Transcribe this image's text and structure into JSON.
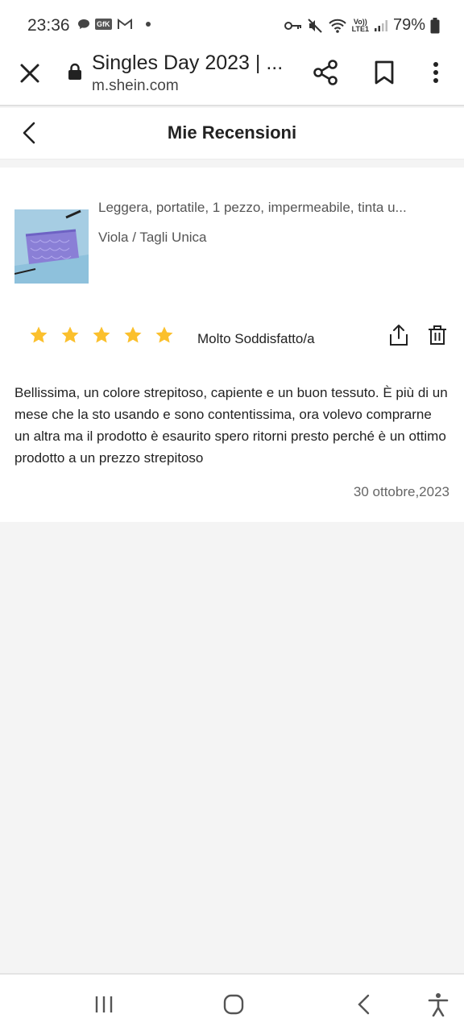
{
  "status_bar": {
    "time": "23:36",
    "gfk_badge": "GfK",
    "lte_top": "Vo))",
    "lte_bottom": "LTE1",
    "battery": "79%",
    "icons": [
      "chat-bubble-icon",
      "gfk-icon",
      "gmail-icon",
      "notification-dot-icon",
      "key-icon",
      "mute-icon",
      "wifi-icon",
      "signal-icon",
      "battery-icon"
    ]
  },
  "browser": {
    "title": "Singles Day 2023 | ...",
    "url": "m.shein.com",
    "icons": [
      "close-icon",
      "lock-icon",
      "share-icon",
      "bookmark-icon",
      "more-vert-icon"
    ]
  },
  "header": {
    "title": "Mie Recensioni",
    "back_icon": "chevron-left-icon"
  },
  "review": {
    "product_name": "Leggera, portatile, 1 pezzo, impermeabile, tinta u...",
    "variant": "Viola / Tagli Unica",
    "rating": 5,
    "rating_max": 5,
    "rating_label": "Molto Soddisfatto/a",
    "text": "Bellissima, un colore strepitoso, capiente e un buon tessuto. È più di un mese che la sto usando e sono contentissima, ora volevo comprarne un altra ma il prodotto è esaurito spero ritorni presto perché è un ottimo prodotto a un prezzo strepitoso",
    "date": "30 ottobre,2023"
  },
  "colors": {
    "star": "#fbc02d",
    "background": "#f4f4f4",
    "card": "#ffffff",
    "product_purple": "#8a7fd6"
  },
  "navbar": {
    "icons": [
      "recents-icon",
      "home-icon",
      "back-icon",
      "accessibility-icon"
    ]
  }
}
